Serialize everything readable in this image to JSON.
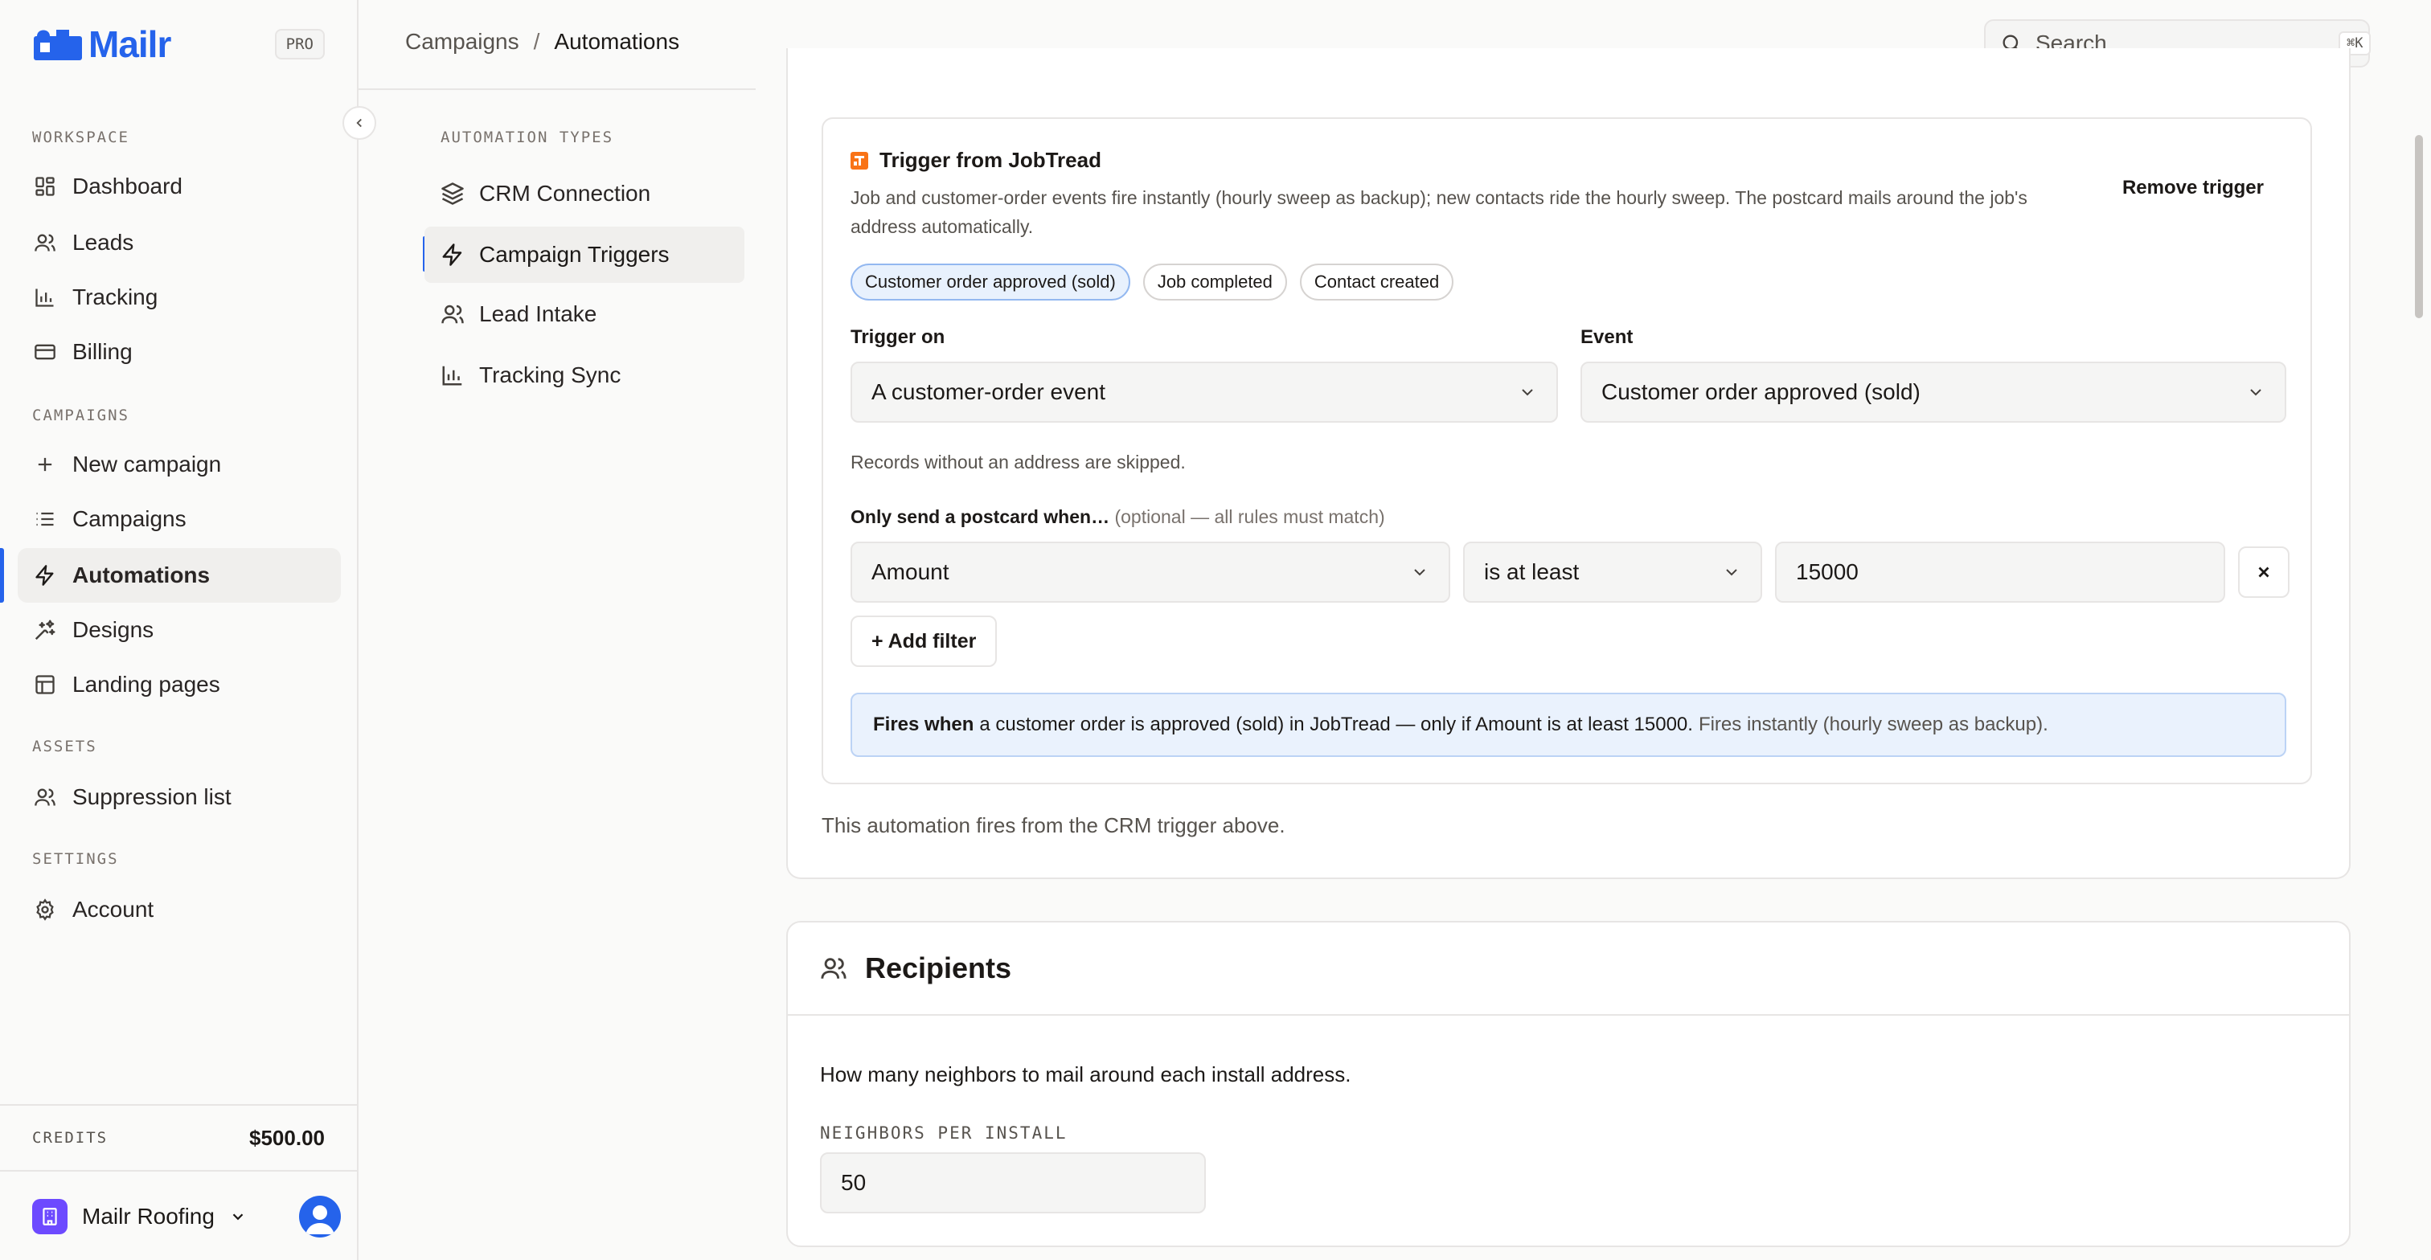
{
  "app": {
    "brand": "Mailr",
    "plan_badge": "PRO",
    "brand_color": "#2563eb"
  },
  "sidebar": {
    "sections": [
      {
        "title": "WORKSPACE",
        "items": [
          {
            "label": "Dashboard",
            "icon": "dashboard-icon"
          },
          {
            "label": "Leads",
            "icon": "users-icon"
          },
          {
            "label": "Tracking",
            "icon": "bar-chart-icon"
          },
          {
            "label": "Billing",
            "icon": "credit-card-icon"
          }
        ]
      },
      {
        "title": "CAMPAIGNS",
        "items": [
          {
            "label": "New campaign",
            "icon": "plus-icon"
          },
          {
            "label": "Campaigns",
            "icon": "list-icon"
          },
          {
            "label": "Automations",
            "icon": "bolt-icon",
            "active": true
          },
          {
            "label": "Designs",
            "icon": "sparkle-brush-icon"
          },
          {
            "label": "Landing pages",
            "icon": "layout-icon"
          }
        ]
      },
      {
        "title": "ASSETS",
        "items": [
          {
            "label": "Suppression list",
            "icon": "users-icon"
          }
        ]
      },
      {
        "title": "SETTINGS",
        "items": [
          {
            "label": "Account",
            "icon": "gear-icon"
          }
        ]
      }
    ],
    "credits_label": "CREDITS",
    "credits_value": "$500.00",
    "org_name": "Mailr Roofing",
    "org_color": "#6d4aff"
  },
  "topbar": {
    "breadcrumb": [
      "Campaigns",
      "Automations"
    ],
    "search_placeholder": "Search...",
    "search_shortcut": "⌘K"
  },
  "subnav": {
    "title": "AUTOMATION TYPES",
    "items": [
      {
        "label": "CRM Connection",
        "icon": "layers-icon"
      },
      {
        "label": "Campaign Triggers",
        "icon": "bolt-icon",
        "active": true
      },
      {
        "label": "Lead Intake",
        "icon": "users-icon"
      },
      {
        "label": "Tracking Sync",
        "icon": "bar-chart-icon"
      }
    ]
  },
  "trigger": {
    "title": "Trigger from JobTread",
    "description": "Job and customer-order events fire instantly (hourly sweep as backup); new contacts ride the hourly sweep. The postcard mails around the job's address automatically.",
    "remove_label": "Remove trigger",
    "chips": [
      "Customer order approved (sold)",
      "Job completed",
      "Contact created"
    ],
    "selected_chip": 0,
    "trigger_on_label": "Trigger on",
    "trigger_on_value": "A customer-order event",
    "event_label": "Event",
    "event_value": "Customer order approved (sold)",
    "skip_note": "Records without an address are skipped.",
    "filter_heading": "Only send a postcard when…",
    "filter_heading_hint": "(optional — all rules must match)",
    "filter": {
      "field": "Amount",
      "operator": "is at least",
      "value": "15000"
    },
    "add_filter_label": "+ Add filter",
    "summary_strong": "Fires when",
    "summary_text": "a customer order is approved (sold) in JobTread — only if Amount is at least 15000.",
    "summary_muted": "Fires instantly (hourly sweep as backup)."
  },
  "automation_note": "This automation fires from the CRM trigger above.",
  "recipients": {
    "title": "Recipients",
    "description": "How many neighbors to mail around each install address.",
    "neighbors_label": "NEIGHBORS PER INSTALL",
    "neighbors_value": "50"
  }
}
